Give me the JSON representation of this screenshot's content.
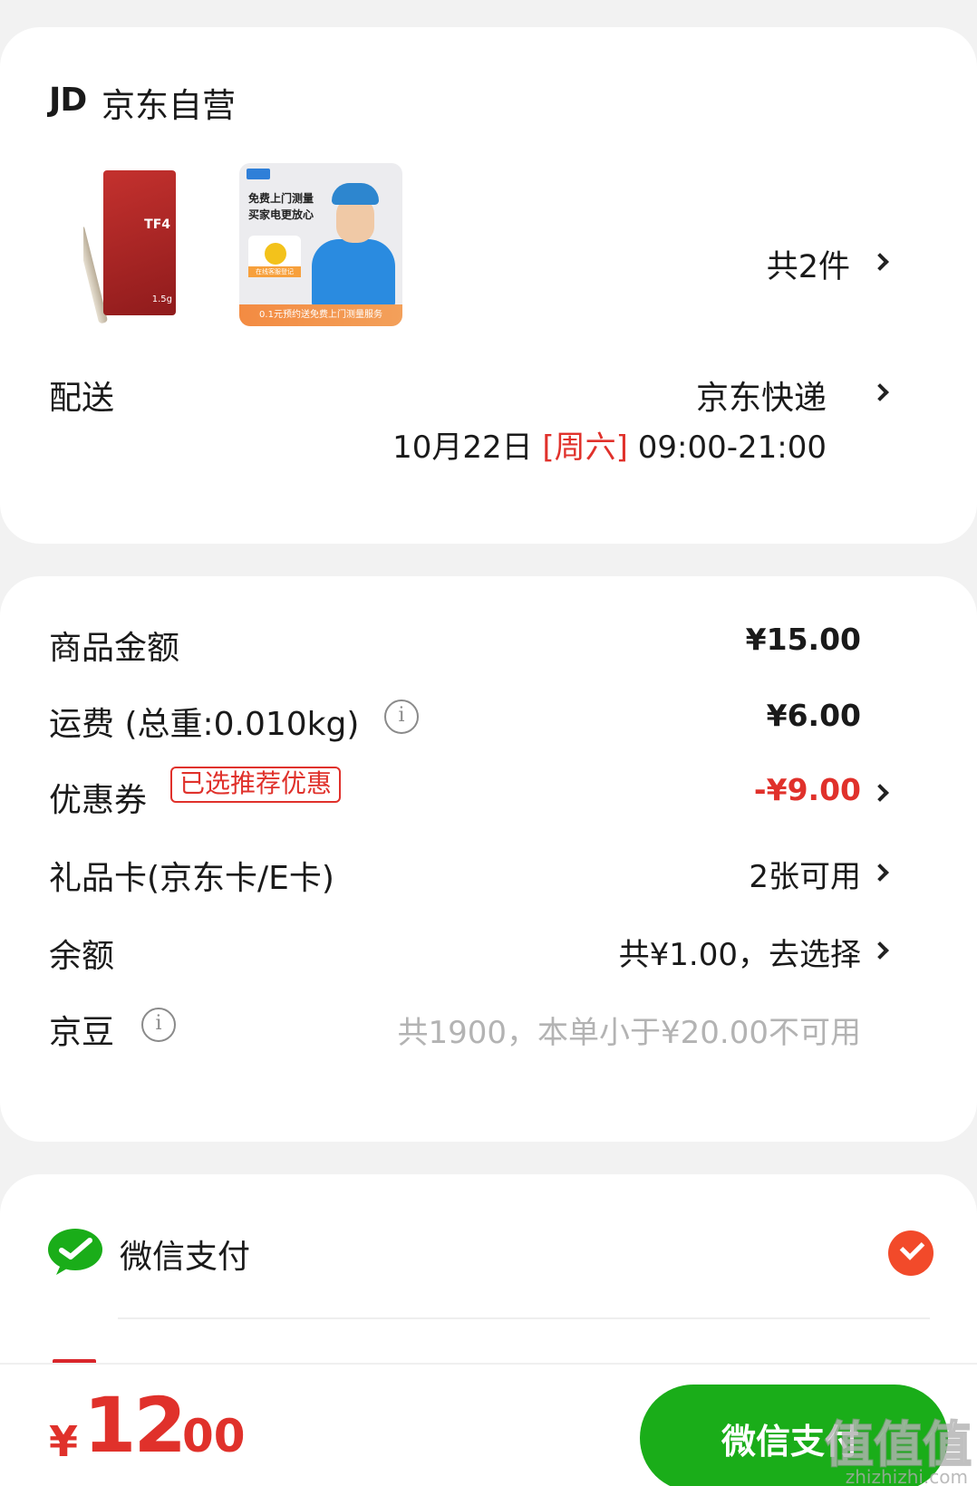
{
  "shop": {
    "logo_text": "JD",
    "name": "京东自营",
    "product_count_label": "共2件",
    "product_1": {
      "pack_text": "TF4",
      "weight": "1.5g"
    },
    "product_2": {
      "line1": "免费上门测量",
      "line2": "买家电更放心",
      "tag": "在线客服登记",
      "bottom": "0.1元预约送免费上门测量服务"
    }
  },
  "delivery": {
    "label": "配送",
    "service": "京东快递",
    "date": "10月22日",
    "weekday": "[周六]",
    "time": "09:00-21:00"
  },
  "price_rows": {
    "goods": {
      "label": "商品金额",
      "value": "¥15.00"
    },
    "shipping": {
      "label": "运费 (总重:0.010kg)",
      "value": "¥6.00"
    },
    "coupon": {
      "label": "优惠券",
      "badge": "已选推荐优惠",
      "value": "-¥9.00"
    },
    "gift_card": {
      "label": "礼品卡(京东卡/E卡)",
      "value": "2张可用"
    },
    "balance": {
      "label": "余额",
      "value": "共¥1.00，去选择"
    },
    "jingdou": {
      "label": "京豆",
      "value": "共1900，本单小于¥20.00不可用"
    }
  },
  "info_icon_glyph": "i",
  "payment": {
    "method": "微信支付",
    "selected": true
  },
  "bottom_bar": {
    "currency": "¥",
    "total_int": "12",
    "total_dec": ".00",
    "pay_button": "微信支付",
    "watermark": "值值值",
    "watermark_sub": "zhizhizhi.com"
  },
  "colors": {
    "accent_red": "#e0312b",
    "wechat_green": "#1aad19",
    "check_orange": "#f24a2a"
  }
}
